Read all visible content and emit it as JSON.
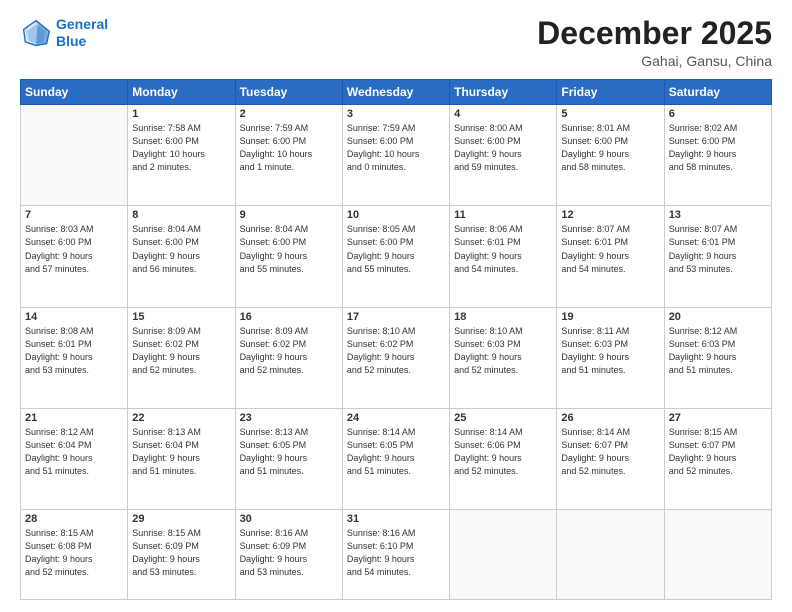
{
  "header": {
    "logo_line1": "General",
    "logo_line2": "Blue",
    "month": "December 2025",
    "location": "Gahai, Gansu, China"
  },
  "days_of_week": [
    "Sunday",
    "Monday",
    "Tuesday",
    "Wednesday",
    "Thursday",
    "Friday",
    "Saturday"
  ],
  "weeks": [
    [
      {
        "day": "",
        "info": ""
      },
      {
        "day": "1",
        "info": "Sunrise: 7:58 AM\nSunset: 6:00 PM\nDaylight: 10 hours\nand 2 minutes."
      },
      {
        "day": "2",
        "info": "Sunrise: 7:59 AM\nSunset: 6:00 PM\nDaylight: 10 hours\nand 1 minute."
      },
      {
        "day": "3",
        "info": "Sunrise: 7:59 AM\nSunset: 6:00 PM\nDaylight: 10 hours\nand 0 minutes."
      },
      {
        "day": "4",
        "info": "Sunrise: 8:00 AM\nSunset: 6:00 PM\nDaylight: 9 hours\nand 59 minutes."
      },
      {
        "day": "5",
        "info": "Sunrise: 8:01 AM\nSunset: 6:00 PM\nDaylight: 9 hours\nand 58 minutes."
      },
      {
        "day": "6",
        "info": "Sunrise: 8:02 AM\nSunset: 6:00 PM\nDaylight: 9 hours\nand 58 minutes."
      }
    ],
    [
      {
        "day": "7",
        "info": "Sunrise: 8:03 AM\nSunset: 6:00 PM\nDaylight: 9 hours\nand 57 minutes."
      },
      {
        "day": "8",
        "info": "Sunrise: 8:04 AM\nSunset: 6:00 PM\nDaylight: 9 hours\nand 56 minutes."
      },
      {
        "day": "9",
        "info": "Sunrise: 8:04 AM\nSunset: 6:00 PM\nDaylight: 9 hours\nand 55 minutes."
      },
      {
        "day": "10",
        "info": "Sunrise: 8:05 AM\nSunset: 6:00 PM\nDaylight: 9 hours\nand 55 minutes."
      },
      {
        "day": "11",
        "info": "Sunrise: 8:06 AM\nSunset: 6:01 PM\nDaylight: 9 hours\nand 54 minutes."
      },
      {
        "day": "12",
        "info": "Sunrise: 8:07 AM\nSunset: 6:01 PM\nDaylight: 9 hours\nand 54 minutes."
      },
      {
        "day": "13",
        "info": "Sunrise: 8:07 AM\nSunset: 6:01 PM\nDaylight: 9 hours\nand 53 minutes."
      }
    ],
    [
      {
        "day": "14",
        "info": "Sunrise: 8:08 AM\nSunset: 6:01 PM\nDaylight: 9 hours\nand 53 minutes."
      },
      {
        "day": "15",
        "info": "Sunrise: 8:09 AM\nSunset: 6:02 PM\nDaylight: 9 hours\nand 52 minutes."
      },
      {
        "day": "16",
        "info": "Sunrise: 8:09 AM\nSunset: 6:02 PM\nDaylight: 9 hours\nand 52 minutes."
      },
      {
        "day": "17",
        "info": "Sunrise: 8:10 AM\nSunset: 6:02 PM\nDaylight: 9 hours\nand 52 minutes."
      },
      {
        "day": "18",
        "info": "Sunrise: 8:10 AM\nSunset: 6:03 PM\nDaylight: 9 hours\nand 52 minutes."
      },
      {
        "day": "19",
        "info": "Sunrise: 8:11 AM\nSunset: 6:03 PM\nDaylight: 9 hours\nand 51 minutes."
      },
      {
        "day": "20",
        "info": "Sunrise: 8:12 AM\nSunset: 6:03 PM\nDaylight: 9 hours\nand 51 minutes."
      }
    ],
    [
      {
        "day": "21",
        "info": "Sunrise: 8:12 AM\nSunset: 6:04 PM\nDaylight: 9 hours\nand 51 minutes."
      },
      {
        "day": "22",
        "info": "Sunrise: 8:13 AM\nSunset: 6:04 PM\nDaylight: 9 hours\nand 51 minutes."
      },
      {
        "day": "23",
        "info": "Sunrise: 8:13 AM\nSunset: 6:05 PM\nDaylight: 9 hours\nand 51 minutes."
      },
      {
        "day": "24",
        "info": "Sunrise: 8:14 AM\nSunset: 6:05 PM\nDaylight: 9 hours\nand 51 minutes."
      },
      {
        "day": "25",
        "info": "Sunrise: 8:14 AM\nSunset: 6:06 PM\nDaylight: 9 hours\nand 52 minutes."
      },
      {
        "day": "26",
        "info": "Sunrise: 8:14 AM\nSunset: 6:07 PM\nDaylight: 9 hours\nand 52 minutes."
      },
      {
        "day": "27",
        "info": "Sunrise: 8:15 AM\nSunset: 6:07 PM\nDaylight: 9 hours\nand 52 minutes."
      }
    ],
    [
      {
        "day": "28",
        "info": "Sunrise: 8:15 AM\nSunset: 6:08 PM\nDaylight: 9 hours\nand 52 minutes."
      },
      {
        "day": "29",
        "info": "Sunrise: 8:15 AM\nSunset: 6:09 PM\nDaylight: 9 hours\nand 53 minutes."
      },
      {
        "day": "30",
        "info": "Sunrise: 8:16 AM\nSunset: 6:09 PM\nDaylight: 9 hours\nand 53 minutes."
      },
      {
        "day": "31",
        "info": "Sunrise: 8:16 AM\nSunset: 6:10 PM\nDaylight: 9 hours\nand 54 minutes."
      },
      {
        "day": "",
        "info": ""
      },
      {
        "day": "",
        "info": ""
      },
      {
        "day": "",
        "info": ""
      }
    ]
  ]
}
